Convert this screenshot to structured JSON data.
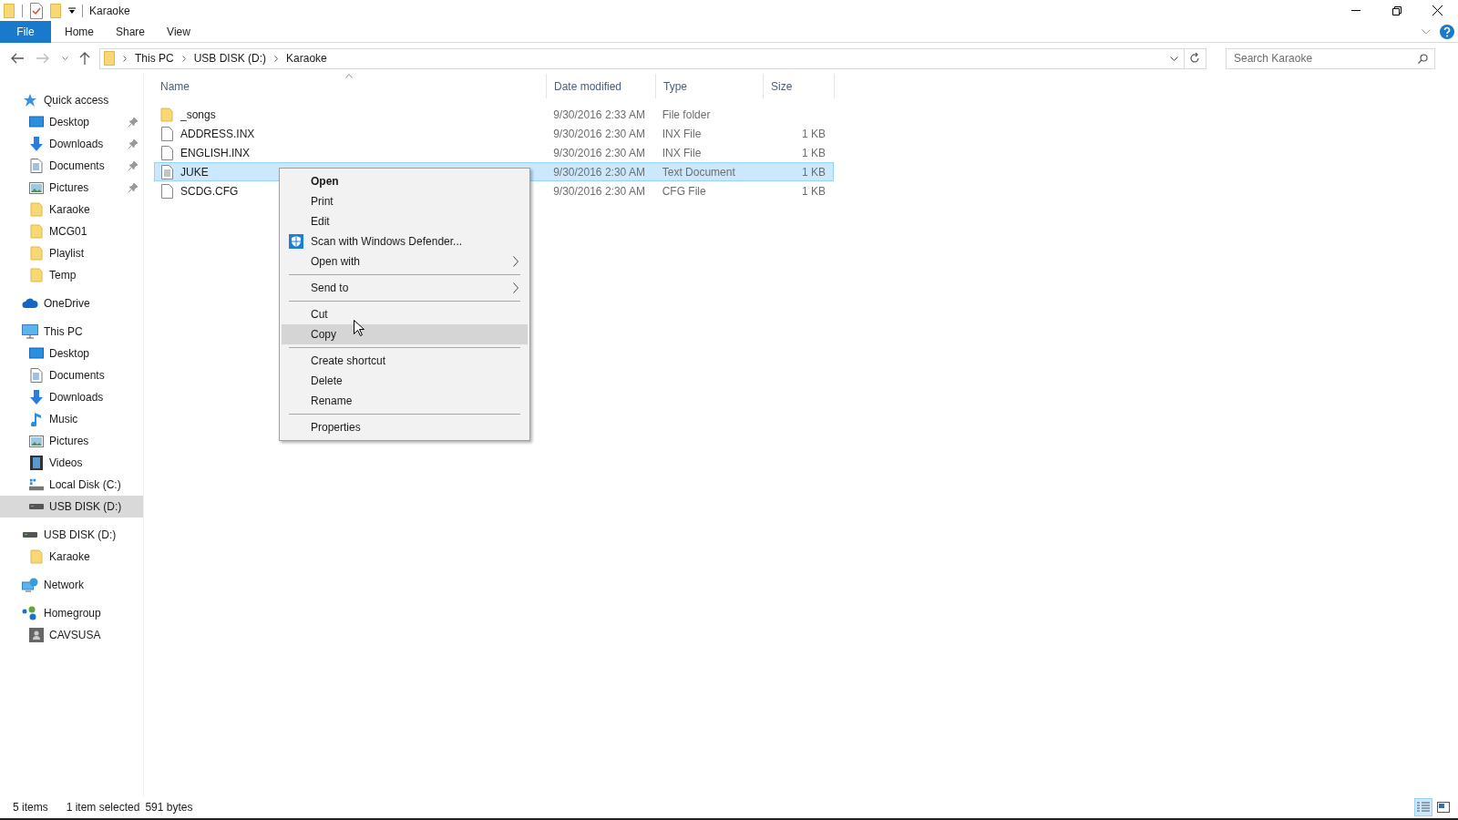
{
  "window": {
    "title": "Karaoke"
  },
  "ribbon_tabs": [
    {
      "label": "File",
      "selected": true
    },
    {
      "label": "Home",
      "selected": false
    },
    {
      "label": "Share",
      "selected": false
    },
    {
      "label": "View",
      "selected": false
    }
  ],
  "address_bar": {
    "path": [
      "This PC",
      "USB DISK (D:)",
      "Karaoke"
    ]
  },
  "search": {
    "placeholder": "Search Karaoke"
  },
  "sidebar": {
    "groups": [
      {
        "label": "Quick access",
        "kind": "star",
        "selected": false,
        "children": [
          {
            "label": "Desktop",
            "kind": "desktop",
            "pinned": true,
            "selected": false
          },
          {
            "label": "Downloads",
            "kind": "download",
            "pinned": true,
            "selected": false
          },
          {
            "label": "Documents",
            "kind": "document",
            "pinned": true,
            "selected": false
          },
          {
            "label": "Pictures",
            "kind": "picture",
            "pinned": true,
            "selected": false
          },
          {
            "label": "Karaoke",
            "kind": "folder",
            "pinned": false,
            "selected": false
          },
          {
            "label": "MCG01",
            "kind": "folder",
            "pinned": false,
            "selected": false
          },
          {
            "label": "Playlist",
            "kind": "folder",
            "pinned": false,
            "selected": false
          },
          {
            "label": "Temp",
            "kind": "folder",
            "pinned": false,
            "selected": false
          }
        ]
      },
      {
        "label": "OneDrive",
        "kind": "cloud",
        "selected": false
      },
      {
        "label": "This PC",
        "kind": "pc",
        "selected": false,
        "children": [
          {
            "label": "Desktop",
            "kind": "desktop",
            "pinned": false,
            "selected": false
          },
          {
            "label": "Documents",
            "kind": "document",
            "pinned": false,
            "selected": false
          },
          {
            "label": "Downloads",
            "kind": "download",
            "pinned": false,
            "selected": false
          },
          {
            "label": "Music",
            "kind": "music",
            "pinned": false,
            "selected": false
          },
          {
            "label": "Pictures",
            "kind": "picture",
            "pinned": false,
            "selected": false
          },
          {
            "label": "Videos",
            "kind": "video",
            "pinned": false,
            "selected": false
          },
          {
            "label": "Local Disk (C:)",
            "kind": "disk",
            "pinned": false,
            "selected": false
          },
          {
            "label": "USB DISK (D:)",
            "kind": "drive",
            "pinned": false,
            "selected": true
          }
        ]
      },
      {
        "label": "USB DISK (D:)",
        "kind": "drive",
        "selected": false,
        "children": [
          {
            "label": "Karaoke",
            "kind": "folder",
            "pinned": false,
            "selected": false
          }
        ]
      },
      {
        "label": "Network",
        "kind": "network",
        "selected": false
      },
      {
        "label": "Homegroup",
        "kind": "homegroup",
        "selected": false,
        "children": [
          {
            "label": "CAVSUSA",
            "kind": "user",
            "pinned": false,
            "selected": false
          }
        ]
      }
    ]
  },
  "file_list": {
    "columns": [
      "Name",
      "Date modified",
      "Type",
      "Size"
    ],
    "rows": [
      {
        "kind": "folder",
        "name": "_songs",
        "date": "9/30/2016 2:33 AM",
        "type": "File folder",
        "selected": false
      },
      {
        "kind": "file",
        "name": "ADDRESS.INX",
        "date": "9/30/2016 2:30 AM",
        "type": "INX File",
        "size": "1 KB",
        "selected": false
      },
      {
        "kind": "file",
        "name": "ENGLISH.INX",
        "date": "9/30/2016 2:30 AM",
        "type": "INX File",
        "size": "1 KB",
        "selected": false
      },
      {
        "kind": "text",
        "name": "JUKE",
        "date": "9/30/2016 2:30 AM",
        "type": "Text Document",
        "size": "1 KB",
        "selected": true
      },
      {
        "kind": "file",
        "name": "SCDG.CFG",
        "date": "9/30/2016 2:30 AM",
        "type": "CFG File",
        "size": "1 KB",
        "selected": false
      }
    ]
  },
  "context_menu": {
    "groups": [
      [
        {
          "label": "Open",
          "default": true,
          "submenu": false,
          "kind": "plain",
          "selected": false
        },
        {
          "label": "Print",
          "default": false,
          "submenu": false,
          "kind": "plain",
          "selected": false
        },
        {
          "label": "Edit",
          "default": false,
          "submenu": false,
          "kind": "plain",
          "selected": false
        },
        {
          "label": "Scan with Windows Defender...",
          "default": false,
          "submenu": false,
          "kind": "shield",
          "selected": false
        },
        {
          "label": "Open with",
          "default": false,
          "submenu": true,
          "kind": "plain",
          "selected": false
        }
      ],
      [
        {
          "label": "Send to",
          "default": false,
          "submenu": true,
          "kind": "plain",
          "selected": false
        }
      ],
      [
        {
          "label": "Cut",
          "default": false,
          "submenu": false,
          "kind": "plain",
          "selected": false
        },
        {
          "label": "Copy",
          "default": false,
          "submenu": false,
          "kind": "plain",
          "selected": true
        }
      ],
      [
        {
          "label": "Create shortcut",
          "default": false,
          "submenu": false,
          "kind": "plain",
          "selected": false
        },
        {
          "label": "Delete",
          "default": false,
          "submenu": false,
          "kind": "plain",
          "selected": false
        },
        {
          "label": "Rename",
          "default": false,
          "submenu": false,
          "kind": "plain",
          "selected": false
        }
      ],
      [
        {
          "label": "Properties",
          "default": false,
          "submenu": false,
          "kind": "plain",
          "selected": false
        }
      ]
    ]
  },
  "status_bar": {
    "item_count": "5 items",
    "selection": "1 item selected",
    "size": "591 bytes",
    "views": [
      {
        "kind": "details",
        "selected": true
      },
      {
        "kind": "tiles",
        "selected": false
      }
    ]
  }
}
